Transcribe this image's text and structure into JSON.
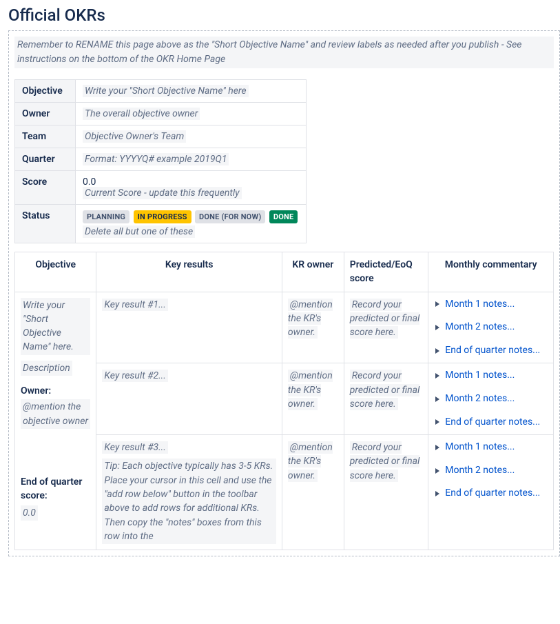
{
  "page": {
    "title": "Official OKRs",
    "intro_note": "Remember to RENAME this page above as the \"Short Objective Name\" and review labels as needed after you publish - See instructions on the bottom of the OKR Home Page"
  },
  "meta": {
    "objective_label": "Objective",
    "objective_placeholder": "Write your \"Short Objective Name\" here",
    "owner_label": "Owner",
    "owner_placeholder": "The overall objective owner",
    "team_label": "Team",
    "team_placeholder": "Objective Owner's Team",
    "quarter_label": "Quarter",
    "quarter_placeholder": "Format: YYYYQ# example 2019Q1",
    "score_label": "Score",
    "score_value": "0.0",
    "score_hint": "Current Score - update this frequently",
    "status_label": "Status",
    "status_planning": "PLANNING",
    "status_inprogress": "IN PROGRESS",
    "status_donefornow": "DONE (FOR NOW)",
    "status_done": "DONE",
    "status_hint": "Delete all but one of these"
  },
  "headers": {
    "objective": "Objective",
    "key_results": "Key results",
    "kr_owner": "KR owner",
    "score": "Predicted/EoQ score",
    "commentary": "Monthly commentary"
  },
  "objective_cell": {
    "name_placeholder": "Write your \"Short Objective Name\" here.",
    "description_placeholder": "Description",
    "owner_label": "Owner:",
    "owner_mention": "@mention the objective owner",
    "eoq_label": "End of quarter score:",
    "eoq_value": "0.0"
  },
  "rows": [
    {
      "kr": "Key result #1...",
      "tip": "",
      "owner": "@mention the KR's owner.",
      "score": "Record your predicted or final score here.",
      "m1": "Month 1 notes...",
      "m2": "Month 2 notes...",
      "eoq": "End of quarter notes..."
    },
    {
      "kr": "Key result #2...",
      "tip": "",
      "owner": "@mention the KR's owner.",
      "score": "Record your predicted or final score here.",
      "m1": "Month 1 notes...",
      "m2": "Month 2 notes...",
      "eoq": "End of quarter notes..."
    },
    {
      "kr": "Key result #3...",
      "tip": "Tip: Each objective typically has 3-5 KRs. Place your cursor in this cell and use the \"add row below\" button in the toolbar above to add rows for additional KRs. Then copy the \"notes\" boxes from this row into the",
      "owner": "@mention the KR's owner.",
      "score": "Record your predicted or final score here.",
      "m1": "Month 1 notes...",
      "m2": "Month 2 notes...",
      "eoq": "End of quarter notes..."
    }
  ]
}
